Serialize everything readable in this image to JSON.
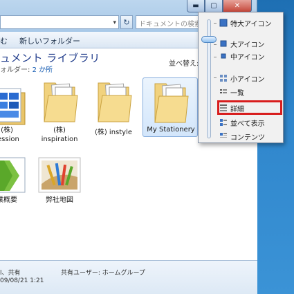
{
  "window": {
    "buttons": {
      "minimize": "▬",
      "maximize": "▢",
      "close": "✕"
    }
  },
  "address": {
    "dropdown": "▾",
    "refresh": "↻"
  },
  "search": {
    "placeholder": "ドキュメントの検索"
  },
  "toolbar": {
    "partial_item": "む",
    "new_folder": "新しいフォルダー"
  },
  "library": {
    "title": "ュメント ライブラリ",
    "subtitle_prefix": "ォルダー: ",
    "subtitle_link": "2 か所",
    "arrange_label": "並べ替え:"
  },
  "files": [
    {
      "label": "(株)\nression",
      "kind": "thumb-blue"
    },
    {
      "label": "(株)\ninspiration",
      "kind": "folder"
    },
    {
      "label": "(株) instyle",
      "kind": "folder"
    },
    {
      "label": "My Stationery",
      "kind": "folder-selected"
    },
    {
      "label": "業概要",
      "kind": "thumb-green"
    },
    {
      "label": "弊社地図",
      "kind": "thumb-photo"
    }
  ],
  "details": {
    "line1_left": "l、共有",
    "line1_right": "共有ユーザー: ホームグループ",
    "line2_left": "09/08/21 1:21"
  },
  "view_menu": {
    "items": [
      {
        "label": "特大アイコン",
        "icon": "extra-large-icons-icon"
      },
      {
        "label": "大アイコン",
        "icon": "large-icons-icon"
      },
      {
        "label": "中アイコン",
        "icon": "medium-icons-icon"
      },
      {
        "label": "小アイコン",
        "icon": "small-icons-icon"
      },
      {
        "label": "一覧",
        "icon": "list-icon"
      },
      {
        "label": "詳細",
        "icon": "details-icon"
      },
      {
        "label": "並べて表示",
        "icon": "tiles-icon"
      },
      {
        "label": "コンテンツ",
        "icon": "content-icon"
      }
    ],
    "highlighted_item": "詳細",
    "highlight_color": "#d81d1d"
  }
}
